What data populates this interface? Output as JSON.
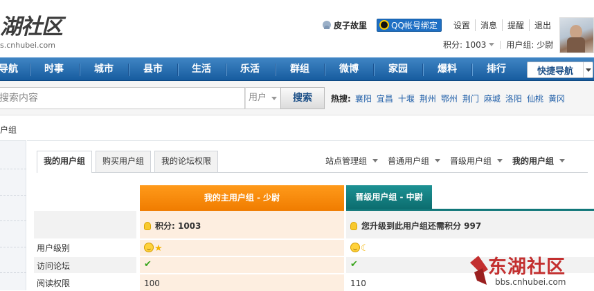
{
  "header": {
    "logo_text": "湖社区",
    "logo_url": "s.cnhubei.com",
    "username": "皮子故里",
    "qq_bind_label": "QQ帐号绑定",
    "top_links": [
      "设置",
      "消息",
      "提醒",
      "退出"
    ],
    "points_label": "积分: 1003",
    "user_group_label": "用户组: 少尉"
  },
  "nav": {
    "items": [
      "导航",
      "时事",
      "城市",
      "县市",
      "生活",
      "乐活",
      "群组",
      "微博",
      "家园",
      "爆料",
      "排行"
    ],
    "quick_nav_label": "快捷导航"
  },
  "search": {
    "placeholder": "搜索内容",
    "type_value": "用户",
    "button_label": "搜索",
    "hot_label": "热搜:",
    "hot_terms": [
      "襄阳",
      "宜昌",
      "十堰",
      "荆州",
      "鄂州",
      "荆门",
      "麻城",
      "洛阳",
      "仙桃",
      "黄冈"
    ]
  },
  "breadcrumb": "户组",
  "tabs": [
    "我的用户组",
    "购买用户组",
    "我的论坛权限"
  ],
  "group_links": [
    "站点管理组",
    "普通用户组",
    "晋级用户组",
    "我的用户组"
  ],
  "table": {
    "main_header": "我的主用户组 - 少尉",
    "next_header": "晋级用户组 - 中尉",
    "main_points": "积分: 1003",
    "next_points": "您升级到此用户组还需积分 997",
    "row_labels": [
      "用户级别",
      "访问论坛",
      "阅读权限"
    ],
    "main_read": "100",
    "next_read": "110"
  },
  "watermark": {
    "title": "东湖社区",
    "url": "bbs.cnhubei.com"
  },
  "colors": {
    "nav_blue": "#175c9f",
    "main_orange": "#f07c00",
    "next_teal": "#117779",
    "watermark_red": "#c32f2f"
  }
}
